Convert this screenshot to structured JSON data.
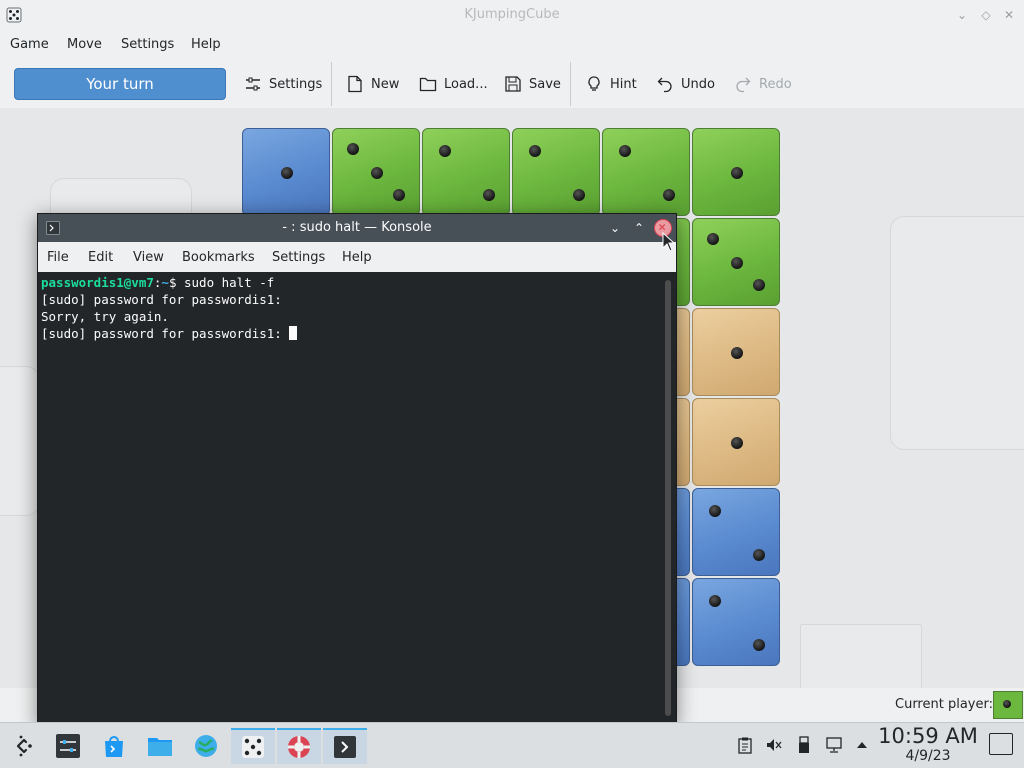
{
  "window": {
    "title": "KJumpingCube",
    "icon": "dice-icon"
  },
  "menubar": {
    "items": [
      "Game",
      "Move",
      "Settings",
      "Help"
    ]
  },
  "toolbar": {
    "turn_label": "Your turn",
    "settings_label": "Settings",
    "new_label": "New",
    "load_label": "Load...",
    "save_label": "Save",
    "hint_label": "Hint",
    "undo_label": "Undo",
    "redo_label": "Redo"
  },
  "board": {
    "colors": {
      "green": "#6cb73e",
      "blue": "#5a8ad0",
      "tan": "#ddb983"
    },
    "visible_cubes": [
      {
        "row": 0,
        "col": 0,
        "color": "blue",
        "pips": 1
      },
      {
        "row": 0,
        "col": 1,
        "color": "green",
        "pips": 3
      },
      {
        "row": 0,
        "col": 2,
        "color": "green",
        "pips": 2
      },
      {
        "row": 0,
        "col": 3,
        "color": "green",
        "pips": 2
      },
      {
        "row": 0,
        "col": 4,
        "color": "green",
        "pips": 2
      },
      {
        "row": 0,
        "col": 5,
        "color": "green",
        "pips": 1
      },
      {
        "row": 1,
        "col": 5,
        "color": "green",
        "pips": 3
      },
      {
        "row": 2,
        "col": 5,
        "color": "tan",
        "pips": 1
      },
      {
        "row": 3,
        "col": 5,
        "color": "tan",
        "pips": 1
      },
      {
        "row": 4,
        "col": 5,
        "color": "blue",
        "pips": 2
      },
      {
        "row": 5,
        "col": 5,
        "color": "blue",
        "pips": 2
      }
    ]
  },
  "statusbar": {
    "current_player_label": "Current player:",
    "current_player_color": "#6cb73e"
  },
  "konsole": {
    "title": "- : sudo halt — Konsole",
    "menu": [
      "File",
      "Edit",
      "View",
      "Bookmarks",
      "Settings",
      "Help"
    ],
    "prompt_user": "passwordis1@vm7",
    "prompt_path": "~",
    "command": "$ sudo halt -f",
    "lines": [
      "[sudo] password for passwordis1:",
      "Sorry, try again.",
      "[sudo] password for passwordis1: "
    ]
  },
  "taskbar": {
    "launchers": [
      "application-launcher-icon",
      "system-settings-icon",
      "discover-store-icon",
      "file-manager-icon",
      "web-browser-icon",
      "kjumpingcube-icon",
      "help-lifebuoy-icon",
      "konsole-icon"
    ],
    "tray": [
      "clipboard-icon",
      "volume-muted-icon",
      "usb-device-icon",
      "network-icon",
      "expand-tray-icon"
    ],
    "time": "10:59 AM",
    "date": "4/9/23"
  }
}
